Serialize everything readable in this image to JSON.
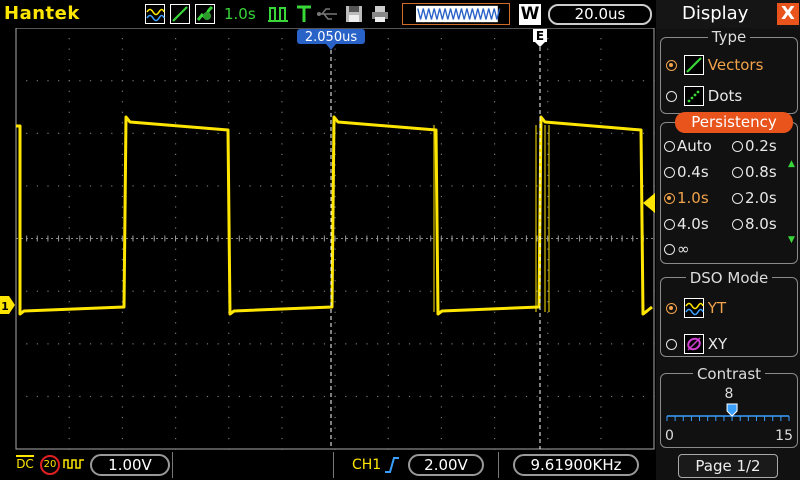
{
  "topbar": {
    "brand": "Hantek",
    "persistence_time": "1.0s",
    "timebase": "20.0us",
    "waveform_mode_badge": "W",
    "icons": [
      "acquire-normal-icon",
      "vector-draw-icon",
      "persistence-icon",
      "run-stop-icon",
      "trigger-icon",
      "usb-icon",
      "save-icon",
      "print-icon"
    ]
  },
  "display": {
    "trigger_time_marker": "2.050us",
    "trigger_marker_letter": "E",
    "ch1_marker": "1",
    "trace_color": "#ffe600"
  },
  "bottombar": {
    "coupling": "DC",
    "bw_limit": "20",
    "ch1_volts_div": "1.00V",
    "trigger_source": "CH1",
    "trigger_level": "2.00V",
    "frequency": "9.61900KHz"
  },
  "panel": {
    "title": "Display",
    "close": "X",
    "type": {
      "title": "Type",
      "options": [
        "Vectors",
        "Dots"
      ],
      "selected": "Vectors"
    },
    "persistency": {
      "title": "Persistency",
      "options": [
        "Auto",
        "0.2s",
        "0.4s",
        "0.8s",
        "1.0s",
        "2.0s",
        "4.0s",
        "8.0s",
        "∞"
      ],
      "selected": "1.0s"
    },
    "dso_mode": {
      "title": "DSO Mode",
      "options": [
        "YT",
        "XY"
      ],
      "selected": "YT"
    },
    "contrast": {
      "title": "Contrast",
      "value": "8",
      "min": "0",
      "max": "15",
      "level": 8
    },
    "page": "Page 1/2"
  },
  "colors": {
    "accent": "#e8541c",
    "selected": "#f1a24a",
    "trace": "#ffe600",
    "green": "#39d63a",
    "panel_bg": "#111111"
  }
}
